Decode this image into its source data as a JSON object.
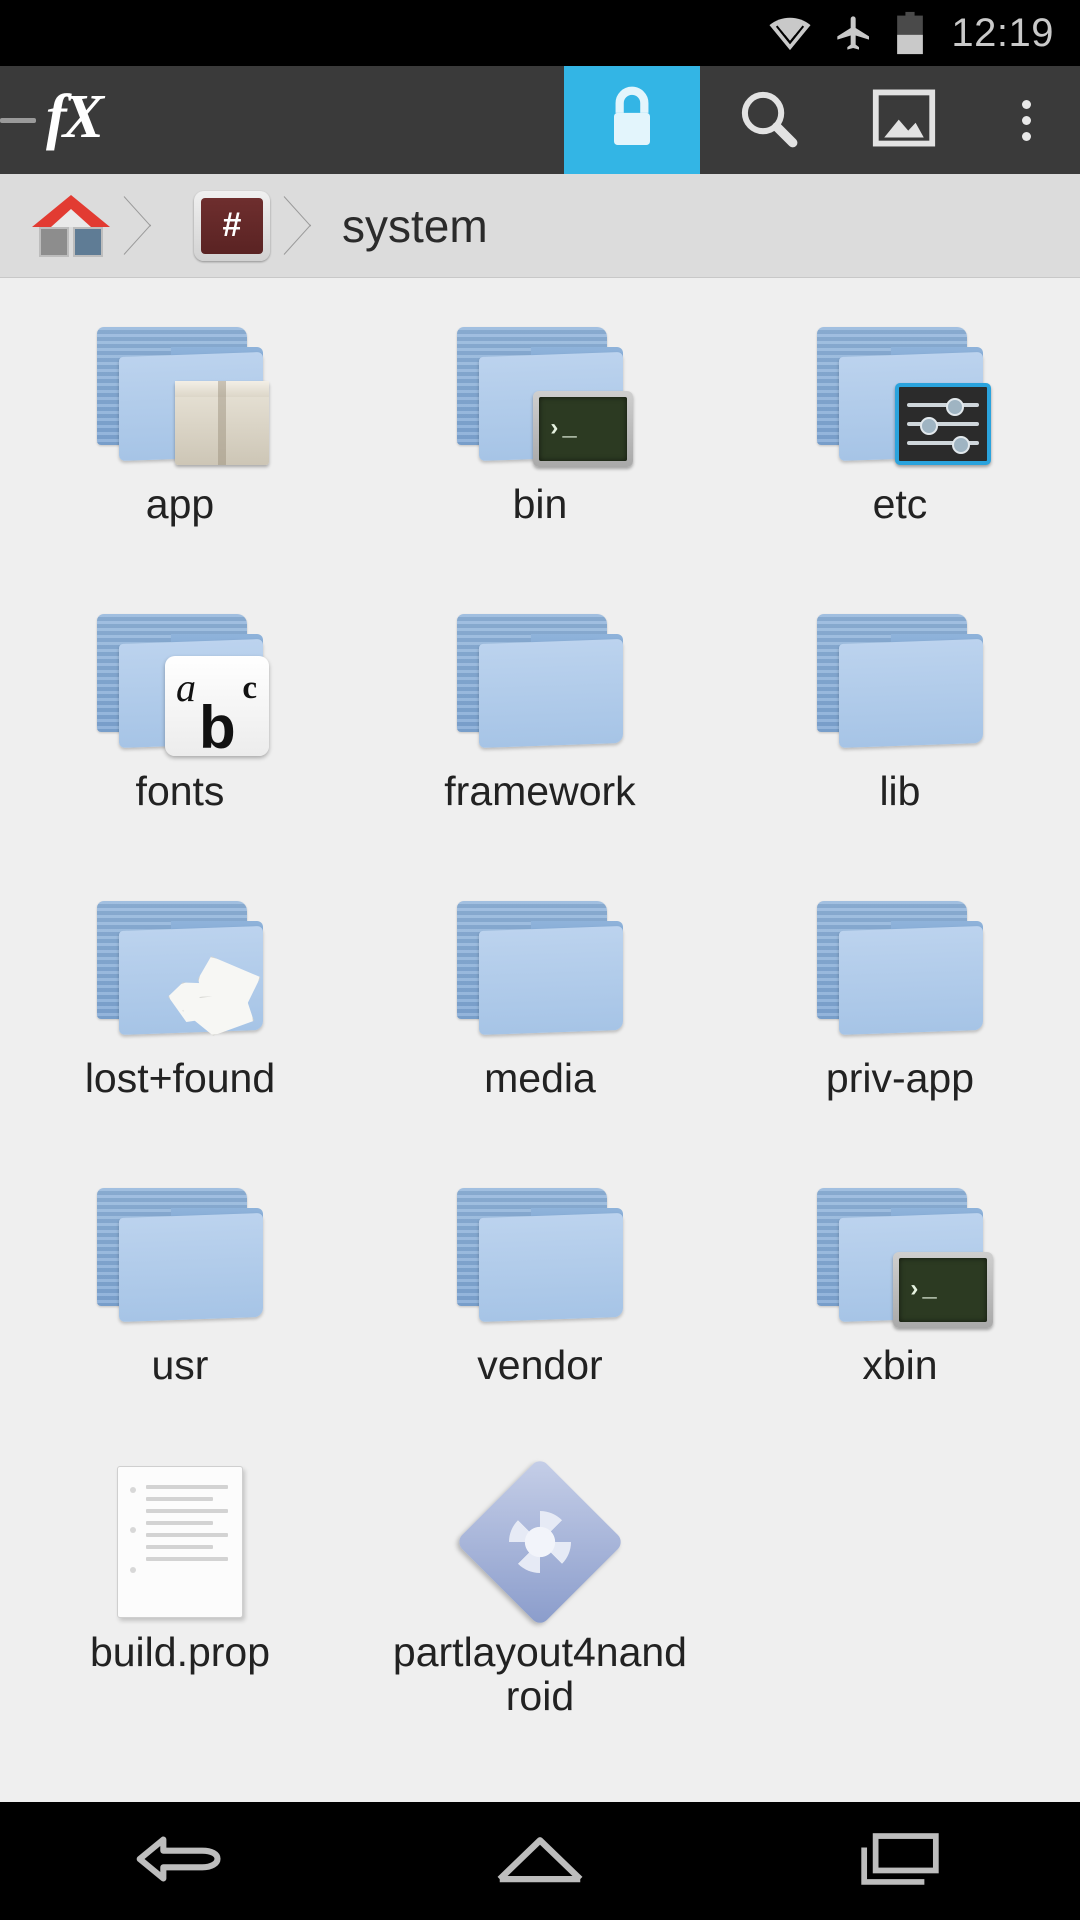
{
  "status_bar": {
    "time": "12:19",
    "icons": [
      "wifi-icon",
      "airplane-mode-icon",
      "battery-icon"
    ],
    "battery_level_pct": 45,
    "background": "#000000",
    "text_color": "#c9c9c9"
  },
  "toolbar": {
    "app_logo": "fX",
    "drawer_handle": "drawer-dash",
    "background": "#3a3a3a",
    "active_background": "#33b5e5",
    "buttons": [
      {
        "name": "root-lock-button",
        "icon": "lock-icon",
        "active": true
      },
      {
        "name": "search-button",
        "icon": "search-icon",
        "active": false
      },
      {
        "name": "gallery-button",
        "icon": "image-icon",
        "active": false
      },
      {
        "name": "overflow-button",
        "icon": "more-vertical-icon",
        "active": false
      }
    ]
  },
  "breadcrumb": {
    "background": "#dcdcdc",
    "items": [
      {
        "label": "",
        "icon": "home-icon"
      },
      {
        "label": "",
        "icon": "root-hash-icon"
      },
      {
        "label": "system",
        "icon": ""
      }
    ],
    "current_path_label": "system"
  },
  "file_grid": {
    "columns": 3,
    "background": "#efefef",
    "items": [
      {
        "label": "app",
        "icon": "folder-package-icon",
        "type": "folder"
      },
      {
        "label": "bin",
        "icon": "folder-terminal-icon",
        "type": "folder"
      },
      {
        "label": "etc",
        "icon": "folder-settings-icon",
        "type": "folder"
      },
      {
        "label": "fonts",
        "icon": "folder-fonts-icon",
        "type": "folder"
      },
      {
        "label": "framework",
        "icon": "folder-icon",
        "type": "folder"
      },
      {
        "label": "lib",
        "icon": "folder-icon",
        "type": "folder"
      },
      {
        "label": "lost+found",
        "icon": "folder-crumpled-icon",
        "type": "folder"
      },
      {
        "label": "media",
        "icon": "folder-icon",
        "type": "folder"
      },
      {
        "label": "priv-app",
        "icon": "folder-icon",
        "type": "folder"
      },
      {
        "label": "usr",
        "icon": "folder-icon",
        "type": "folder"
      },
      {
        "label": "vendor",
        "icon": "folder-icon",
        "type": "folder"
      },
      {
        "label": "xbin",
        "icon": "folder-terminal-icon",
        "type": "folder"
      },
      {
        "label": "build.prop",
        "icon": "text-document-icon",
        "type": "file"
      },
      {
        "label": "partlayout4nandroid",
        "icon": "diamond-gear-icon",
        "type": "file"
      }
    ]
  },
  "nav_bar": {
    "background": "#000000",
    "buttons": [
      {
        "name": "back-button",
        "icon": "back-arrow-icon"
      },
      {
        "name": "home-button",
        "icon": "home-outline-icon"
      },
      {
        "name": "recents-button",
        "icon": "recents-icon"
      }
    ]
  }
}
